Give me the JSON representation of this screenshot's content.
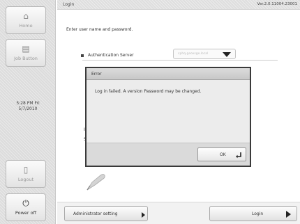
{
  "sidebar": {
    "home": {
      "label": "Home",
      "icon": "home-icon"
    },
    "job_button": {
      "label": "Job Button",
      "icon": "job-list-icon"
    },
    "clock": {
      "time": "5:28 PM  Fri",
      "date": "5/7/2010"
    },
    "logout": {
      "label": "Logout",
      "icon": "logout-icon"
    },
    "power": {
      "label": "Power off",
      "icon": "power-icon"
    }
  },
  "header": {
    "title": "Login",
    "version": "Ver.2.0.11004.23001"
  },
  "main": {
    "prompt": "Enter user name and password.",
    "auth_label": "Authentication Server",
    "auth_value": "cphq.geoxsge.local",
    "partial_label_1": "I",
    "partial_label_2": "S"
  },
  "dialog": {
    "title": "Error",
    "message": "Log in failed. A version Password may be changed.",
    "ok_label": "OK"
  },
  "footer": {
    "admin_label": "Administrator setting",
    "login_label": "Login"
  }
}
